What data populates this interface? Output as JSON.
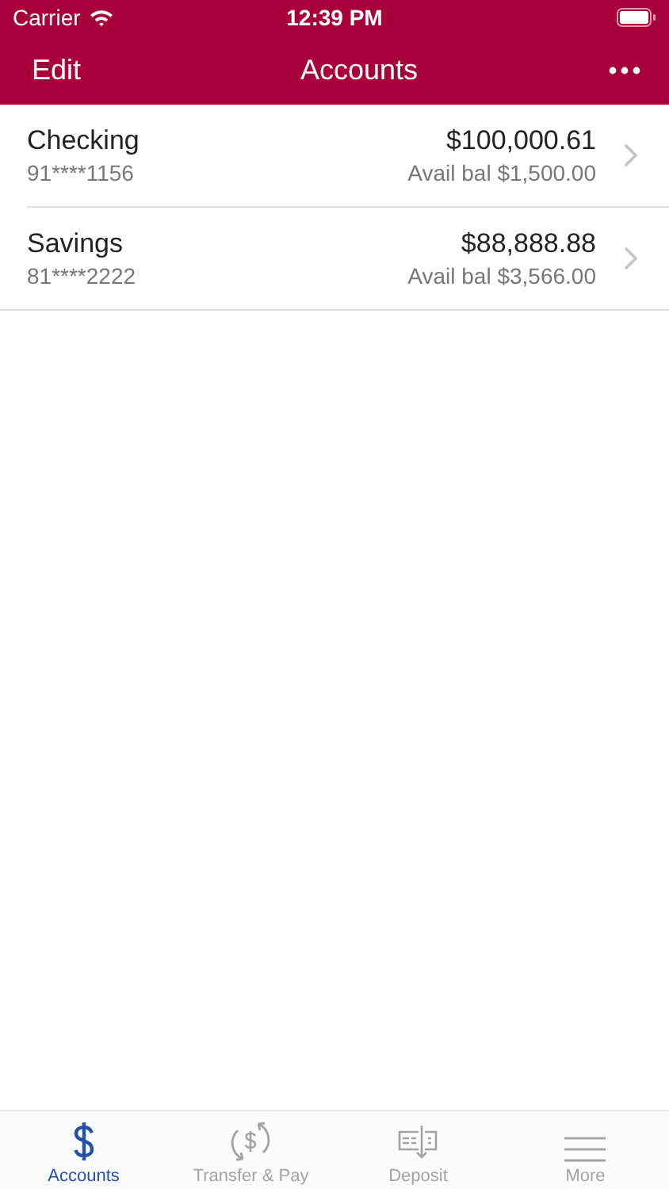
{
  "status_bar": {
    "carrier": "Carrier",
    "time": "12:39 PM"
  },
  "nav": {
    "left": "Edit",
    "title": "Accounts"
  },
  "accounts": [
    {
      "name": "Checking",
      "number": "91****1156",
      "balance": "$100,000.61",
      "available": "Avail bal $1,500.00"
    },
    {
      "name": "Savings",
      "number": "81****2222",
      "balance": "$88,888.88",
      "available": "Avail bal $3,566.00"
    }
  ],
  "tabs": [
    {
      "kind": "dollar",
      "label": "Accounts",
      "selected": true
    },
    {
      "kind": "transfer",
      "label": "Transfer & Pay",
      "selected": false
    },
    {
      "kind": "deposit",
      "label": "Deposit",
      "selected": false
    },
    {
      "kind": "more",
      "label": "More",
      "selected": false
    }
  ]
}
